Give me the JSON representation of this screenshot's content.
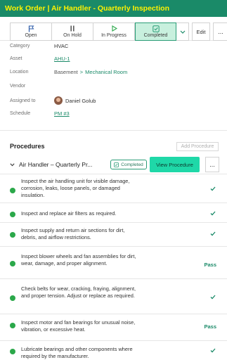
{
  "header": {
    "title": "Work Order | Air Handler - Quarterly Inspection"
  },
  "status_bar": {
    "buttons": [
      {
        "label": "Open",
        "icon": "flag-icon"
      },
      {
        "label": "On Hold",
        "icon": "pause-icon"
      },
      {
        "label": "In Progress",
        "icon": "play-icon"
      },
      {
        "label": "Completed",
        "icon": "check-square-icon",
        "active": true
      }
    ],
    "caret_icon": "chevron-down-icon",
    "edit_label": "Edit",
    "more_label": "..."
  },
  "details": [
    {
      "label": "Category",
      "value": "HVAC",
      "type": "text"
    },
    {
      "label": "Asset",
      "value": "AHU-1",
      "type": "link"
    },
    {
      "label": "Location",
      "value": "Basement",
      "value2": "Mechanical Room",
      "separator": ">",
      "type": "location"
    },
    {
      "label": "Vendor",
      "value": "",
      "type": "text"
    },
    {
      "label": "Assigned to",
      "value": "Daniel Golub",
      "type": "user"
    },
    {
      "label": "Schedule",
      "value": "PM #3",
      "type": "link"
    }
  ],
  "procedures": {
    "title": "Procedures",
    "add_label": "Add Procedure",
    "group": {
      "name": "Air Handler – Quarterly Pr...",
      "badge": "Completed",
      "view_label": "View Procedure",
      "more_label": "..."
    },
    "tasks": [
      {
        "text": "Inspect the air handling unit for visible damage, corrosion, leaks, loose panels, or damaged insulation.",
        "result": "check"
      },
      {
        "text": "Inspect and replace air filters as required.",
        "result": "check"
      },
      {
        "text": "Inspect supply and return air sections for dirt, debris, and airflow restrictions.",
        "result": "check"
      },
      {
        "text": "Inspect blower wheels and fan assemblies for dirt, wear, damage, and proper alignment.",
        "result": "Pass"
      },
      {
        "text": "Check belts for wear, cracking, fraying, alignment, and proper tension. Adjust or replace as required.",
        "result": "check"
      },
      {
        "text": "Inspect motor and fan bearings for unusual noise, vibration, or excessive heat.",
        "result": "Pass"
      },
      {
        "text": "Lubricate bearings and other components where required by the manufacturer.",
        "result": "check"
      }
    ]
  },
  "colors": {
    "brand": "#1a8a68",
    "title_text": "#fff200",
    "accent": "#1fd8a8",
    "done": "#2ba84a"
  }
}
